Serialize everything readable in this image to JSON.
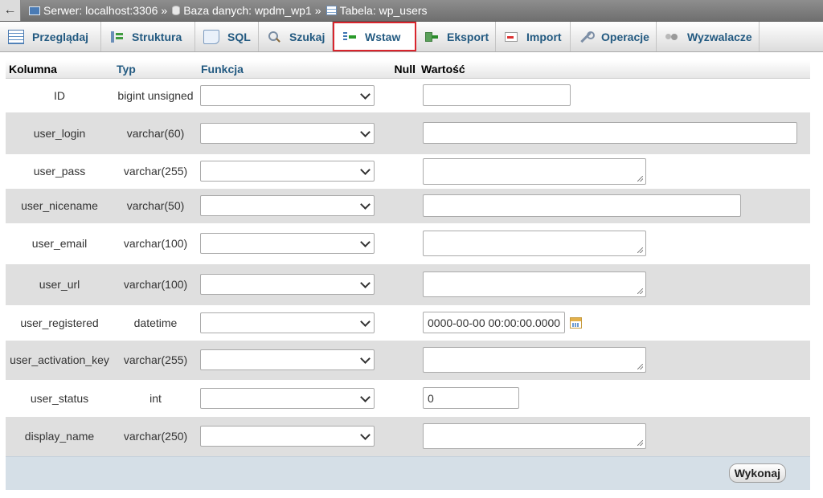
{
  "breadcrumb": {
    "back_label": "←",
    "server_label": "Serwer: localhost:3306",
    "sep1": "»",
    "database_label": "Baza danych: wpdm_wp1",
    "sep2": "»",
    "table_label": "Tabela: wp_users"
  },
  "tabs": [
    {
      "label": "Przeglądaj",
      "icon": "browse-icon"
    },
    {
      "label": "Struktura",
      "icon": "structure-icon"
    },
    {
      "label": "SQL",
      "icon": "sql-icon"
    },
    {
      "label": "Szukaj",
      "icon": "search-icon"
    },
    {
      "label": "Wstaw",
      "icon": "insert-icon",
      "active": true
    },
    {
      "label": "Eksport",
      "icon": "export-icon"
    },
    {
      "label": "Import",
      "icon": "import-icon"
    },
    {
      "label": "Operacje",
      "icon": "operations-icon"
    },
    {
      "label": "Wyzwalacze",
      "icon": "triggers-icon"
    }
  ],
  "table": {
    "headers": {
      "column": "Kolumna",
      "type": "Typ",
      "function": "Funkcja",
      "null": "Null",
      "value": "Wartość"
    },
    "rows": [
      {
        "name": "ID",
        "type": "bigint unsigned",
        "value": ""
      },
      {
        "name": "user_login",
        "type": "varchar(60)",
        "value": ""
      },
      {
        "name": "user_pass",
        "type": "varchar(255)",
        "value": ""
      },
      {
        "name": "user_nicename",
        "type": "varchar(50)",
        "value": ""
      },
      {
        "name": "user_email",
        "type": "varchar(100)",
        "value": ""
      },
      {
        "name": "user_url",
        "type": "varchar(100)",
        "value": ""
      },
      {
        "name": "user_registered",
        "type": "datetime",
        "value": "0000-00-00 00:00:00.0000"
      },
      {
        "name": "user_activation_key",
        "type": "varchar(255)",
        "value": ""
      },
      {
        "name": "user_status",
        "type": "int",
        "value": "0"
      },
      {
        "name": "display_name",
        "type": "varchar(250)",
        "value": ""
      }
    ]
  },
  "submit_label": "Wykonaj",
  "colors": {
    "link": "#235a81",
    "active_tab_border": "#d9252d",
    "row_alt": "#dfdfdf",
    "footer": "#d5dfe7"
  }
}
